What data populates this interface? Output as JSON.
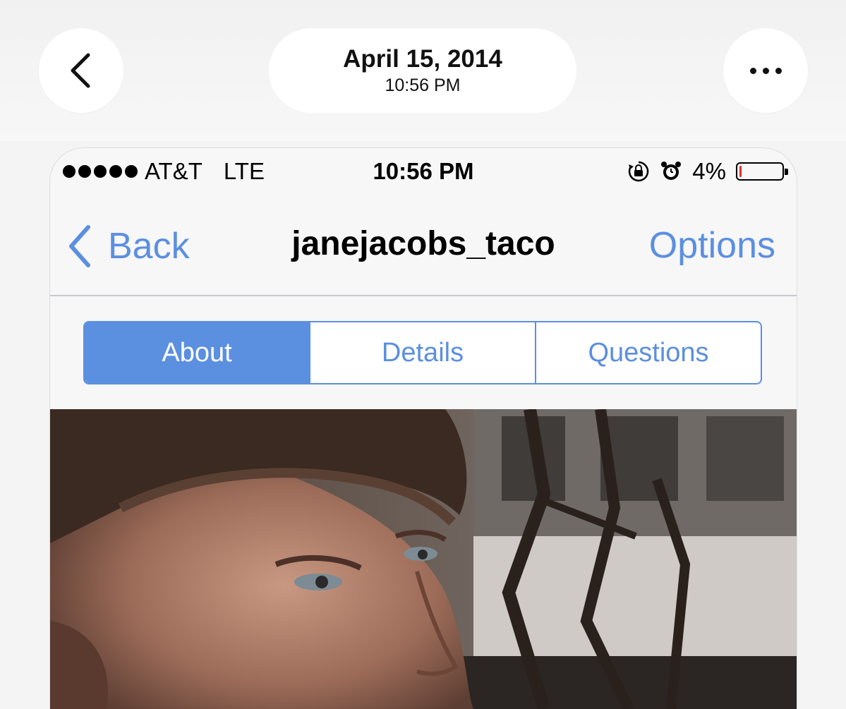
{
  "viewer": {
    "date": "April 15, 2014",
    "time": "10:56 PM",
    "back_icon": "chevron-left-icon",
    "more_icon": "ellipsis-icon"
  },
  "status_bar": {
    "carrier": "AT&T",
    "network": "LTE",
    "clock": "10:56 PM",
    "battery": "4%",
    "battery_fraction": 0.04,
    "battery_color": "#e62c2c"
  },
  "nav": {
    "back_label": "Back",
    "title": "janejacobs_taco",
    "options_label": "Options",
    "accent": "#5b8fe0"
  },
  "segments": [
    {
      "label": "About",
      "active": true
    },
    {
      "label": "Details",
      "active": false
    },
    {
      "label": "Questions",
      "active": false
    }
  ]
}
